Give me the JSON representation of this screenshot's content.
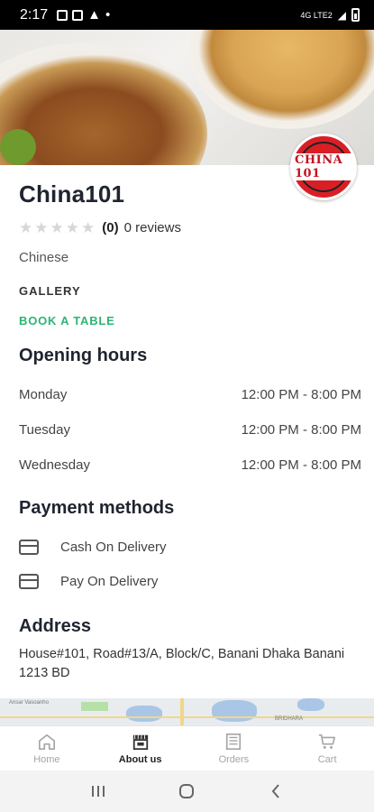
{
  "status_bar": {
    "time": "2:17",
    "network": "4G LTE2"
  },
  "restaurant": {
    "name": "China101",
    "logo_text": "CHINA 101",
    "rating_count": "(0)",
    "reviews_label": "0 reviews",
    "cuisine": "Chinese",
    "gallery_label": "GALLERY",
    "book_label": "BOOK A TABLE",
    "rating_value": 0,
    "rating_max": 5
  },
  "hours": {
    "title": "Opening hours",
    "rows": [
      {
        "day": "Monday",
        "time": "12:00 PM - 8:00 PM"
      },
      {
        "day": "Tuesday",
        "time": "12:00 PM - 8:00 PM"
      },
      {
        "day": "Wednesday",
        "time": "12:00 PM - 8:00 PM"
      }
    ]
  },
  "payment": {
    "title": "Payment methods",
    "methods": [
      {
        "label": "Cash On Delivery",
        "icon": "credit-card-icon"
      },
      {
        "label": "Pay On Delivery",
        "icon": "credit-card-icon"
      }
    ]
  },
  "address": {
    "title": "Address",
    "text": "House#101, Road#13/A, Block/C, Banani Dhaka Banani 1213 BD"
  },
  "map_labels": {
    "left": "Ansar Vasoanho",
    "right": "BRIDHARA"
  },
  "bottom_nav": {
    "items": [
      {
        "label": "Home",
        "icon": "home-icon"
      },
      {
        "label": "About us",
        "icon": "store-icon",
        "active": true
      },
      {
        "label": "Orders",
        "icon": "orders-icon"
      },
      {
        "label": "Cart",
        "icon": "cart-icon"
      }
    ]
  },
  "colors": {
    "accent_green": "#2bb673",
    "logo_red": "#d91f26",
    "title_dark": "#1f2430"
  }
}
